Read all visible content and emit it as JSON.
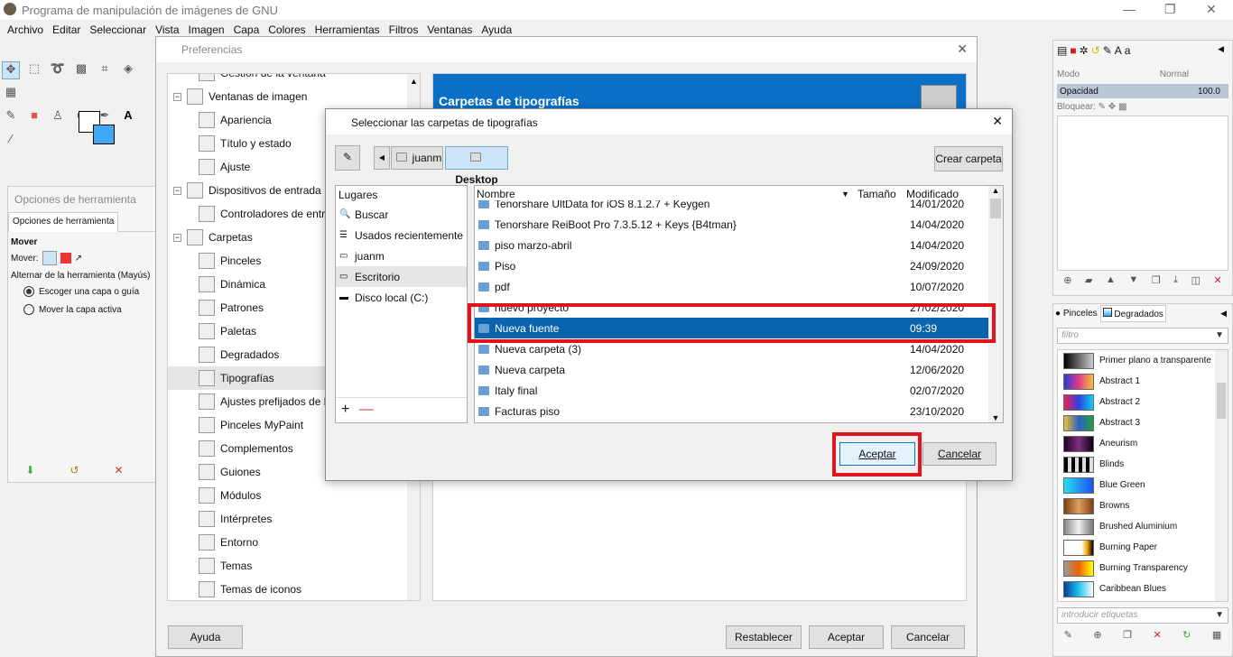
{
  "app": {
    "title": "Programa de manipulación de imágenes de GNU",
    "menu": [
      "Archivo",
      "Editar",
      "Seleccionar",
      "Vista",
      "Imagen",
      "Capa",
      "Colores",
      "Herramientas",
      "Filtros",
      "Ventanas",
      "Ayuda"
    ]
  },
  "tool_options": {
    "title": "Opciones de herramienta",
    "tab": "Opciones de herramienta",
    "tool": "Mover",
    "move_label": "Mover:",
    "toggle_label": "Alternar de la herramienta  (Mayús)",
    "options": [
      "Escoger una capa o guía",
      "Mover la capa activa"
    ],
    "selected": 0
  },
  "prefs": {
    "title": "Preferencias",
    "tree": [
      {
        "label": "Gestión de la ventana",
        "indent": 2
      },
      {
        "label": "Ventanas de imagen",
        "indent": 1
      },
      {
        "label": "Apariencia",
        "indent": 2
      },
      {
        "label": "Título y estado",
        "indent": 2
      },
      {
        "label": "Ajuste",
        "indent": 2
      },
      {
        "label": "Dispositivos de entrada",
        "indent": 1
      },
      {
        "label": "Controladores de entrada",
        "indent": 2
      },
      {
        "label": "Carpetas",
        "indent": 1
      },
      {
        "label": "Pinceles",
        "indent": 2
      },
      {
        "label": "Dinámica",
        "indent": 2
      },
      {
        "label": "Patrones",
        "indent": 2
      },
      {
        "label": "Paletas",
        "indent": 2
      },
      {
        "label": "Degradados",
        "indent": 2
      },
      {
        "label": "Tipografías",
        "indent": 2,
        "selected": true
      },
      {
        "label": "Ajustes prefijados de herramientas",
        "indent": 2
      },
      {
        "label": "Pinceles MyPaint",
        "indent": 2
      },
      {
        "label": "Complementos",
        "indent": 2
      },
      {
        "label": "Guiones",
        "indent": 2
      },
      {
        "label": "Módulos",
        "indent": 2
      },
      {
        "label": "Intérpretes",
        "indent": 2
      },
      {
        "label": "Entorno",
        "indent": 2
      },
      {
        "label": "Temas",
        "indent": 2
      },
      {
        "label": "Temas de iconos",
        "indent": 2
      }
    ],
    "header": "Carpetas de tipografías",
    "buttons": {
      "help": "Ayuda",
      "reset": "Restablecer",
      "ok": "Aceptar",
      "cancel": "Cancelar"
    }
  },
  "chooser": {
    "title": "Seleccionar las carpetas de tipografías",
    "path": [
      "juanm",
      "Desktop"
    ],
    "create_folder": "Crear carpeta",
    "places_header": "Lugares",
    "places": [
      "Buscar",
      "Usados recientemente",
      "juanm",
      "Escritorio",
      "Disco local (C:)"
    ],
    "columns": {
      "name": "Nombre",
      "size": "Tamaño",
      "modified": "Modificado"
    },
    "files": [
      {
        "name": "Tenorshare UltData for iOS 8.1.2.7 + Keygen",
        "modified": "14/01/2020"
      },
      {
        "name": "Tenorshare ReiBoot Pro 7.3.5.12 + Keys {B4tman}",
        "modified": "14/04/2020"
      },
      {
        "name": "piso marzo-abril",
        "modified": "14/04/2020"
      },
      {
        "name": "Piso",
        "modified": "24/09/2020"
      },
      {
        "name": "pdf",
        "modified": "10/07/2020"
      },
      {
        "name": "nuevo proyecto",
        "modified": "27/02/2020"
      },
      {
        "name": "Nueva fuente",
        "modified": "09:39",
        "selected": true
      },
      {
        "name": "Nueva carpeta (3)",
        "modified": "14/04/2020"
      },
      {
        "name": "Nueva carpeta",
        "modified": "12/06/2020"
      },
      {
        "name": "Italy final",
        "modified": "02/07/2020"
      },
      {
        "name": "Facturas piso",
        "modified": "23/10/2020"
      }
    ],
    "ok": "Aceptar",
    "cancel": "Cancelar"
  },
  "layers": {
    "mode_label": "Modo",
    "mode": "Normal",
    "opacity_label": "Opacidad",
    "opacity": "100.0",
    "lock_label": "Bloquear:"
  },
  "gradients": {
    "tabs": [
      "Pinceles",
      "Degradados"
    ],
    "filter_placeholder": "filtro",
    "tags_placeholder": "introducir etiquetas",
    "items": [
      {
        "name": "Primer plano a transparente",
        "css": "linear-gradient(90deg,#000,#ccc)"
      },
      {
        "name": "Abstract 1",
        "css": "linear-gradient(90deg,#2a3bd6,#e23a8a,#f3c23d)"
      },
      {
        "name": "Abstract 2",
        "css": "linear-gradient(90deg,#f02050,#3040e0,#10d0f0)"
      },
      {
        "name": "Abstract 3",
        "css": "linear-gradient(90deg,#f0c030,#3060c0,#20a040)"
      },
      {
        "name": "Aneurism",
        "css": "linear-gradient(90deg,#200020,#803080,#100010)"
      },
      {
        "name": "Blinds",
        "css": "repeating-linear-gradient(90deg,#000 0 4px,#ddd 4px 8px)"
      },
      {
        "name": "Blue Green",
        "css": "linear-gradient(90deg,#20e0f0,#2050f0)"
      },
      {
        "name": "Browns",
        "css": "linear-gradient(90deg,#7a4010,#e0a060,#804010)"
      },
      {
        "name": "Brushed Aluminium",
        "css": "linear-gradient(90deg,#888,#eee,#777)"
      },
      {
        "name": "Burning Paper",
        "css": "linear-gradient(90deg,#fff 60%,#f0a000,#000)"
      },
      {
        "name": "Burning Transparency",
        "css": "linear-gradient(90deg,#999,#f06000,#ff0)"
      },
      {
        "name": "Caribbean Blues",
        "css": "linear-gradient(90deg,#0040a0,#20c0f0,#fff)"
      }
    ]
  },
  "colors": {
    "accent": "#0078d7",
    "selection": "#0a64ad",
    "header_blue": "#0a70c6",
    "highlight_red": "#e0141e"
  }
}
